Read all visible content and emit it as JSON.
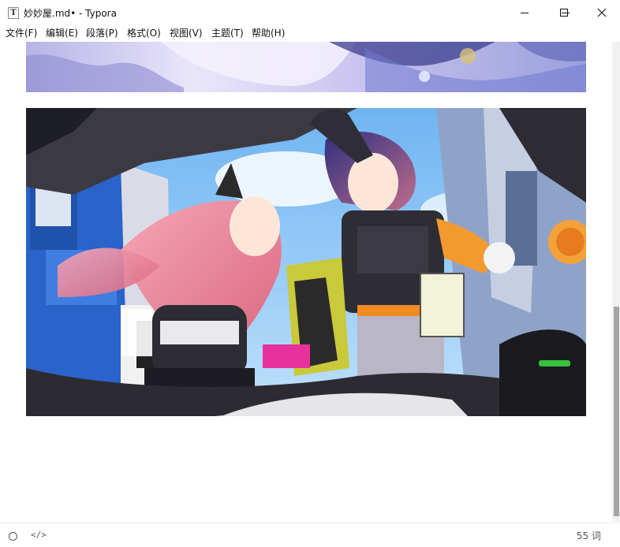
{
  "window": {
    "icon_glyph": "T",
    "title": "妙妙屋.md• - Typora",
    "controls": [
      "minimize-icon",
      "maximize-icon",
      "close-icon"
    ]
  },
  "menu": [
    "文件(F)",
    "编辑(E)",
    "段落(P)",
    "格式(O)",
    "视图(V)",
    "主题(T)",
    "帮助(H)"
  ],
  "document": {
    "images": [
      {
        "kind": "anime illustration (cropped, top part scrolled out of view)"
      },
      {
        "kind": "anime illustration: two characters with a car trunk in a city street"
      }
    ]
  },
  "statusbar": {
    "left_icons": [
      "circle-icon",
      "code-icon"
    ],
    "code_glyph": "</>",
    "word_count": "55 词"
  },
  "colors": {
    "background": "#ffffff",
    "scrollbar_thumb": "#a6a6a6",
    "text": "#111111"
  }
}
